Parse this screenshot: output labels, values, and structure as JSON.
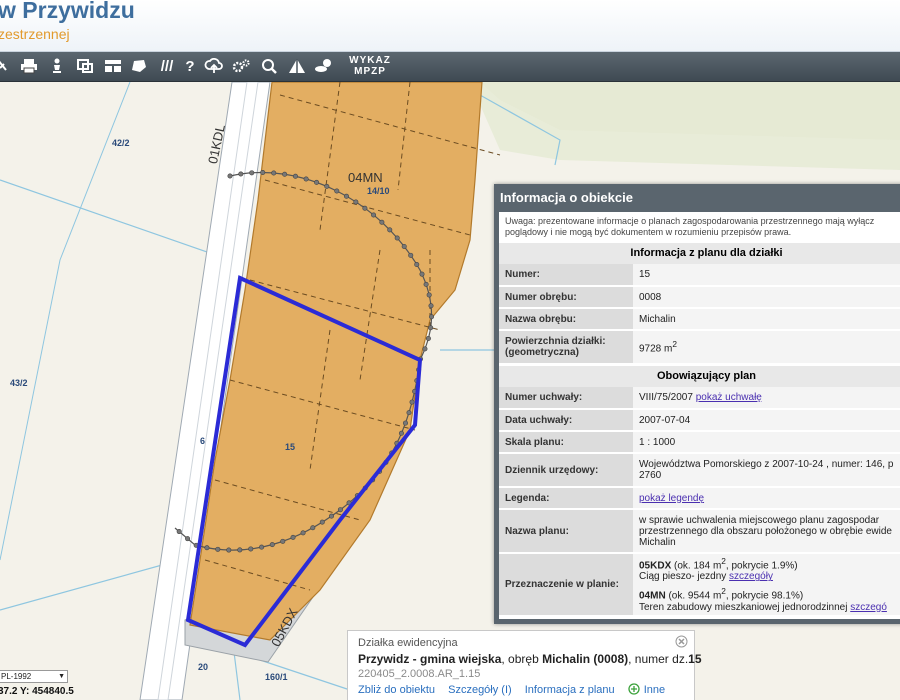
{
  "header": {
    "title": "w Przywidzu",
    "subtitle": "zestrzennej"
  },
  "toolbar": {
    "wykaz_line1": "WYKAZ",
    "wykaz_line2": "MPZP"
  },
  "map": {
    "labels": {
      "plot_42_2": "42/2",
      "plot_43_2": "43/2",
      "road_01kdl": "01KDL",
      "zone_04mn": "04MN",
      "plot_14_10": "14/10",
      "plot_6": "6",
      "plot_15": "15",
      "plot_20": "20",
      "plot_160_1": "160/1",
      "road_05kdx": "05KDX"
    }
  },
  "info": {
    "title": "Informacja o obiekcie",
    "note_line1": "Uwaga: prezentowane informacje o planach zagospodarowania przestrzennego mają wyłącz",
    "note_line2": "poglądowy i nie mogą być dokumentem w rozumieniu przepisów prawa.",
    "section_plot": "Informacja z planu dla działki",
    "numer_label": "Numer:",
    "numer_value": "15",
    "numer_obrebu_label": "Numer obrębu:",
    "numer_obrebu_value": "0008",
    "nazwa_obrebu_label": "Nazwa obrębu:",
    "nazwa_obrebu_value": "Michalin",
    "powierzchnia_label_1": "Powierzchnia działki:",
    "powierzchnia_label_2": "(geometryczna)",
    "powierzchnia_value": "9728 m",
    "powierzchnia_sup": "2",
    "section_plan": "Obowiązujący plan",
    "numer_uchwaly_label": "Numer uchwały:",
    "numer_uchwaly_value": "VIII/75/2007",
    "pokaz_uchwale": "pokaż uchwałę",
    "data_uchwaly_label": "Data uchwały:",
    "data_uchwaly_value": "2007-07-04",
    "skala_label": "Skala planu:",
    "skala_value": "1 : 1000",
    "dziennik_label": "Dziennik urzędowy:",
    "dziennik_value_1": "Województwa Pomorskiego z 2007-10-24 , numer: 146, p",
    "dziennik_value_2": "2760",
    "legenda_label": "Legenda:",
    "pokaz_legende": "pokaż legendę",
    "nazwa_planu_label": "Nazwa planu:",
    "nazwa_planu_1": "w sprawie uchwalenia miejscowego planu zagospodar",
    "nazwa_planu_2": "przestrzennego dla obszaru położonego w obrębie ewide",
    "nazwa_planu_3": "Michalin",
    "przeznaczenie_label": "Przeznaczenie w planie:",
    "z1_code": "05KDX",
    "z1_area": " (ok. 184 m",
    "z1_sup": "2",
    "z1_cov": ", pokrycie 1.9%)",
    "z1_desc": "Ciąg pieszo- jezdny ",
    "szczegoly": "szczegóły",
    "z2_code": "04MN",
    "z2_area": " (ok. 9544 m",
    "z2_sup": "2",
    "z2_cov": ", pokrycie 98.1%)",
    "z2_desc": "Teren zabudowy mieszkaniowej jednorodzinnej ",
    "szczegoly_2": "szczegó"
  },
  "popup": {
    "title": "Działka ewidencyjna",
    "municipality": "Przywidz - gmina wiejska",
    "obreb_text": ", obręb ",
    "obreb_value": "Michalin (0008)",
    "numer_text": ", numer dz.",
    "numer_value": "15",
    "identifier": "220405_2.0008.AR_1.15",
    "link_zoom": "Zbliż do obiektu",
    "link_details": "Szczegóły (I)",
    "link_plan_info": "Informacja z planu",
    "link_more": "Inne"
  },
  "status": {
    "projection": "PL-1992",
    "coordinates": "37.2  Y: 454840.5"
  },
  "colors": {
    "header_title": "#3e6e9e",
    "header_subtitle": "#e29a2c",
    "toolbar_bg": "#4a555e",
    "parcel_fill": "#e3ae62",
    "parcel_highlight": "#2b2bd6",
    "link": "#4a2fb0"
  }
}
